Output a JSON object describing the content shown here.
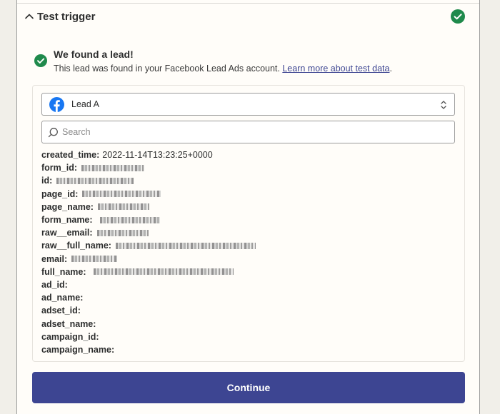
{
  "section": {
    "title": "Test trigger"
  },
  "result": {
    "title": "We found a lead!",
    "description": "This lead was found in your Facebook Lead Ads account. ",
    "link_text": "Learn more about test data",
    "period": "."
  },
  "lead_select": {
    "selected": "Lead A"
  },
  "search": {
    "placeholder": "Search"
  },
  "fields": [
    {
      "key": "created_time:",
      "value": "2022-11-14T13:23:25+0000"
    },
    {
      "key": "form_id:",
      "value": ""
    },
    {
      "key": "id:",
      "value": ""
    },
    {
      "key": "page_id:",
      "value": ""
    },
    {
      "key": "page_name:",
      "value": ""
    },
    {
      "key": "form_name:",
      "value": ""
    },
    {
      "key": "raw__email:",
      "value": ""
    },
    {
      "key": "raw__full_name:",
      "value": ""
    },
    {
      "key": "email:",
      "value": ""
    },
    {
      "key": "full_name:",
      "value": ""
    },
    {
      "key": "ad_id:",
      "value": ""
    },
    {
      "key": "ad_name:",
      "value": ""
    },
    {
      "key": "adset_id:",
      "value": ""
    },
    {
      "key": "adset_name:",
      "value": ""
    },
    {
      "key": "campaign_id:",
      "value": ""
    },
    {
      "key": "campaign_name:",
      "value": ""
    }
  ],
  "actions": {
    "continue_label": "Continue"
  },
  "colors": {
    "accent": "#3d4592",
    "success": "#1f8a4c",
    "facebook": "#1877f2"
  }
}
